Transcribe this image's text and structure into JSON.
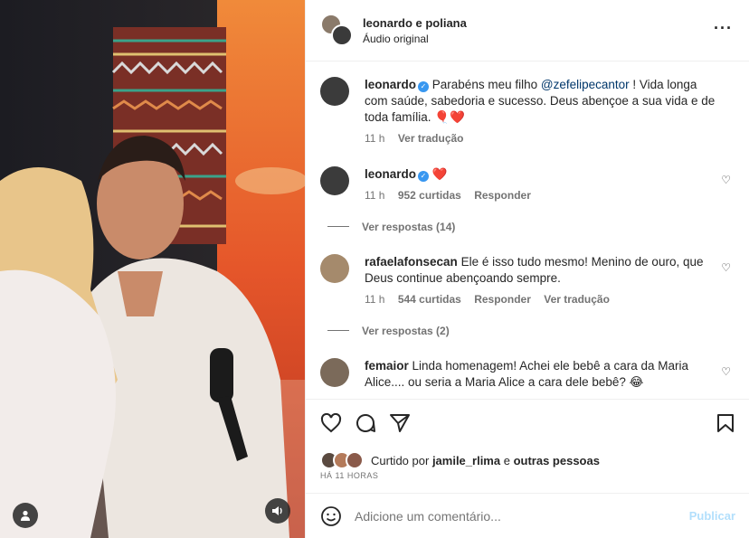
{
  "header": {
    "username": "leonardo e poliana",
    "subtitle": "Áudio original",
    "more_icon": "more-horizontal-icon"
  },
  "comments": [
    {
      "user": "leonardo",
      "verified": true,
      "text_before": "Parabéns meu filho ",
      "mention": "@zefelipecantor",
      "text_after": " ! Vida longa com saúde, sabedoria e sucesso. Deus abençoe a sua vida e de toda família. 🎈❤️",
      "time": "11 h",
      "translate": "Ver tradução"
    },
    {
      "user": "leonardo",
      "verified": true,
      "text": "❤️",
      "time": "11 h",
      "likes": "952 curtidas",
      "reply": "Responder",
      "view_replies": "Ver respostas (14)"
    },
    {
      "user": "rafaelafonsecan",
      "text": "Ele é isso tudo mesmo! Menino de ouro, que Deus continue abençoando sempre.",
      "time": "11 h",
      "likes": "544 curtidas",
      "reply": "Responder",
      "translate": "Ver tradução",
      "view_replies": "Ver respostas (2)"
    },
    {
      "user": "femaior",
      "text": "Linda homenagem! Achei ele bebê a cara da Maria Alice.... ou seria a Maria Alice a cara dele bebê? 😂"
    }
  ],
  "actions": {
    "liked_prefix": "Curtido por",
    "liked_user": "jamile_rlima",
    "liked_suffix": "e",
    "liked_others": "outras pessoas",
    "time_ago": "HÁ 11 HORAS"
  },
  "add_comment": {
    "placeholder": "Adicione um comentário...",
    "post_label": "Publicar"
  },
  "colors": {
    "verified": "#3897f0",
    "mention": "#00376b",
    "muted": "#737373",
    "post_disabled": "#b2dffc"
  }
}
